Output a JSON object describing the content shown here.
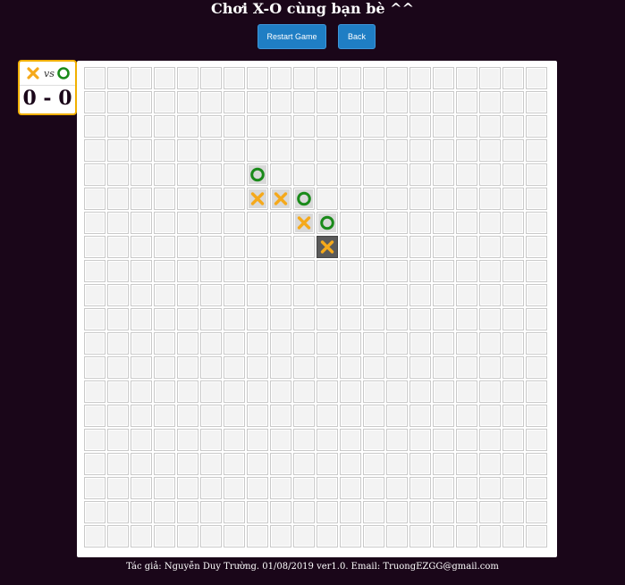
{
  "title": "Chơi X-O cùng bạn bè ^^",
  "buttons": {
    "restart": "Restart Game",
    "back": "Back"
  },
  "score": {
    "vs": "vs",
    "value": "0 - 0"
  },
  "colors": {
    "x": "#f5a91b",
    "o": "#1a8a1a"
  },
  "board": {
    "size": 20,
    "moves": [
      {
        "row": 4,
        "col": 7,
        "mark": "O"
      },
      {
        "row": 5,
        "col": 7,
        "mark": "X"
      },
      {
        "row": 5,
        "col": 8,
        "mark": "X"
      },
      {
        "row": 5,
        "col": 9,
        "mark": "O"
      },
      {
        "row": 6,
        "col": 9,
        "mark": "X"
      },
      {
        "row": 6,
        "col": 10,
        "mark": "O"
      },
      {
        "row": 7,
        "col": 10,
        "mark": "X",
        "last": true
      }
    ]
  },
  "footer": "Tác giả: Nguyễn Duy Trường. 01/08/2019 ver1.0. Email: TruongEZGG@gmail.com"
}
